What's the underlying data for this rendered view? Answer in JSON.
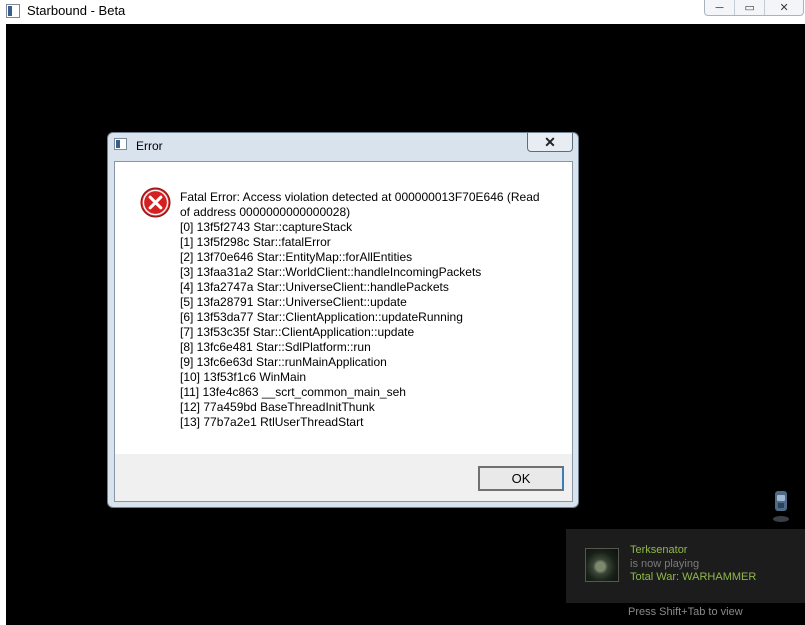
{
  "window": {
    "title": "Starbound - Beta",
    "controls": {
      "minimize": "─",
      "restore": "▭",
      "close": "✕"
    }
  },
  "dialog": {
    "title": "Error",
    "close_glyph": "✕",
    "icon": "error-x-icon",
    "message_lines": [
      "Fatal Error: Access violation detected at 000000013F70E646 (Read of address 0000000000000028)",
      "[0] 13f5f2743 Star::captureStack",
      "[1] 13f5f298c Star::fatalError",
      "[2] 13f70e646 Star::EntityMap::forAllEntities",
      "[3] 13faa31a2 Star::WorldClient::handleIncomingPackets",
      "[4] 13fa2747a Star::UniverseClient::handlePackets",
      "[5] 13fa28791 Star::UniverseClient::update",
      "[6] 13f53da77 Star::ClientApplication::updateRunning",
      "[7] 13f53c35f Star::ClientApplication::update",
      "[8] 13fc6e481 Star::SdlPlatform::run",
      "[9] 13fc6e63d Star::runMainApplication",
      "[10] 13f53f1c6 WinMain",
      "[11] 13fe4c863 __scrt_common_main_seh",
      "[12] 77a459bd BaseThreadInitThunk",
      "[13] 77b7a2e1 RtlUserThreadStart"
    ],
    "ok_label": "OK"
  },
  "notification": {
    "friend_name": "Terksenator",
    "status": "is now playing",
    "game": "Total War: WARHAMMER",
    "hint": "Press Shift+Tab to view",
    "colors": {
      "name": "#8fb84b",
      "status": "#7b7b7b",
      "background": "#1c1c1c"
    }
  }
}
